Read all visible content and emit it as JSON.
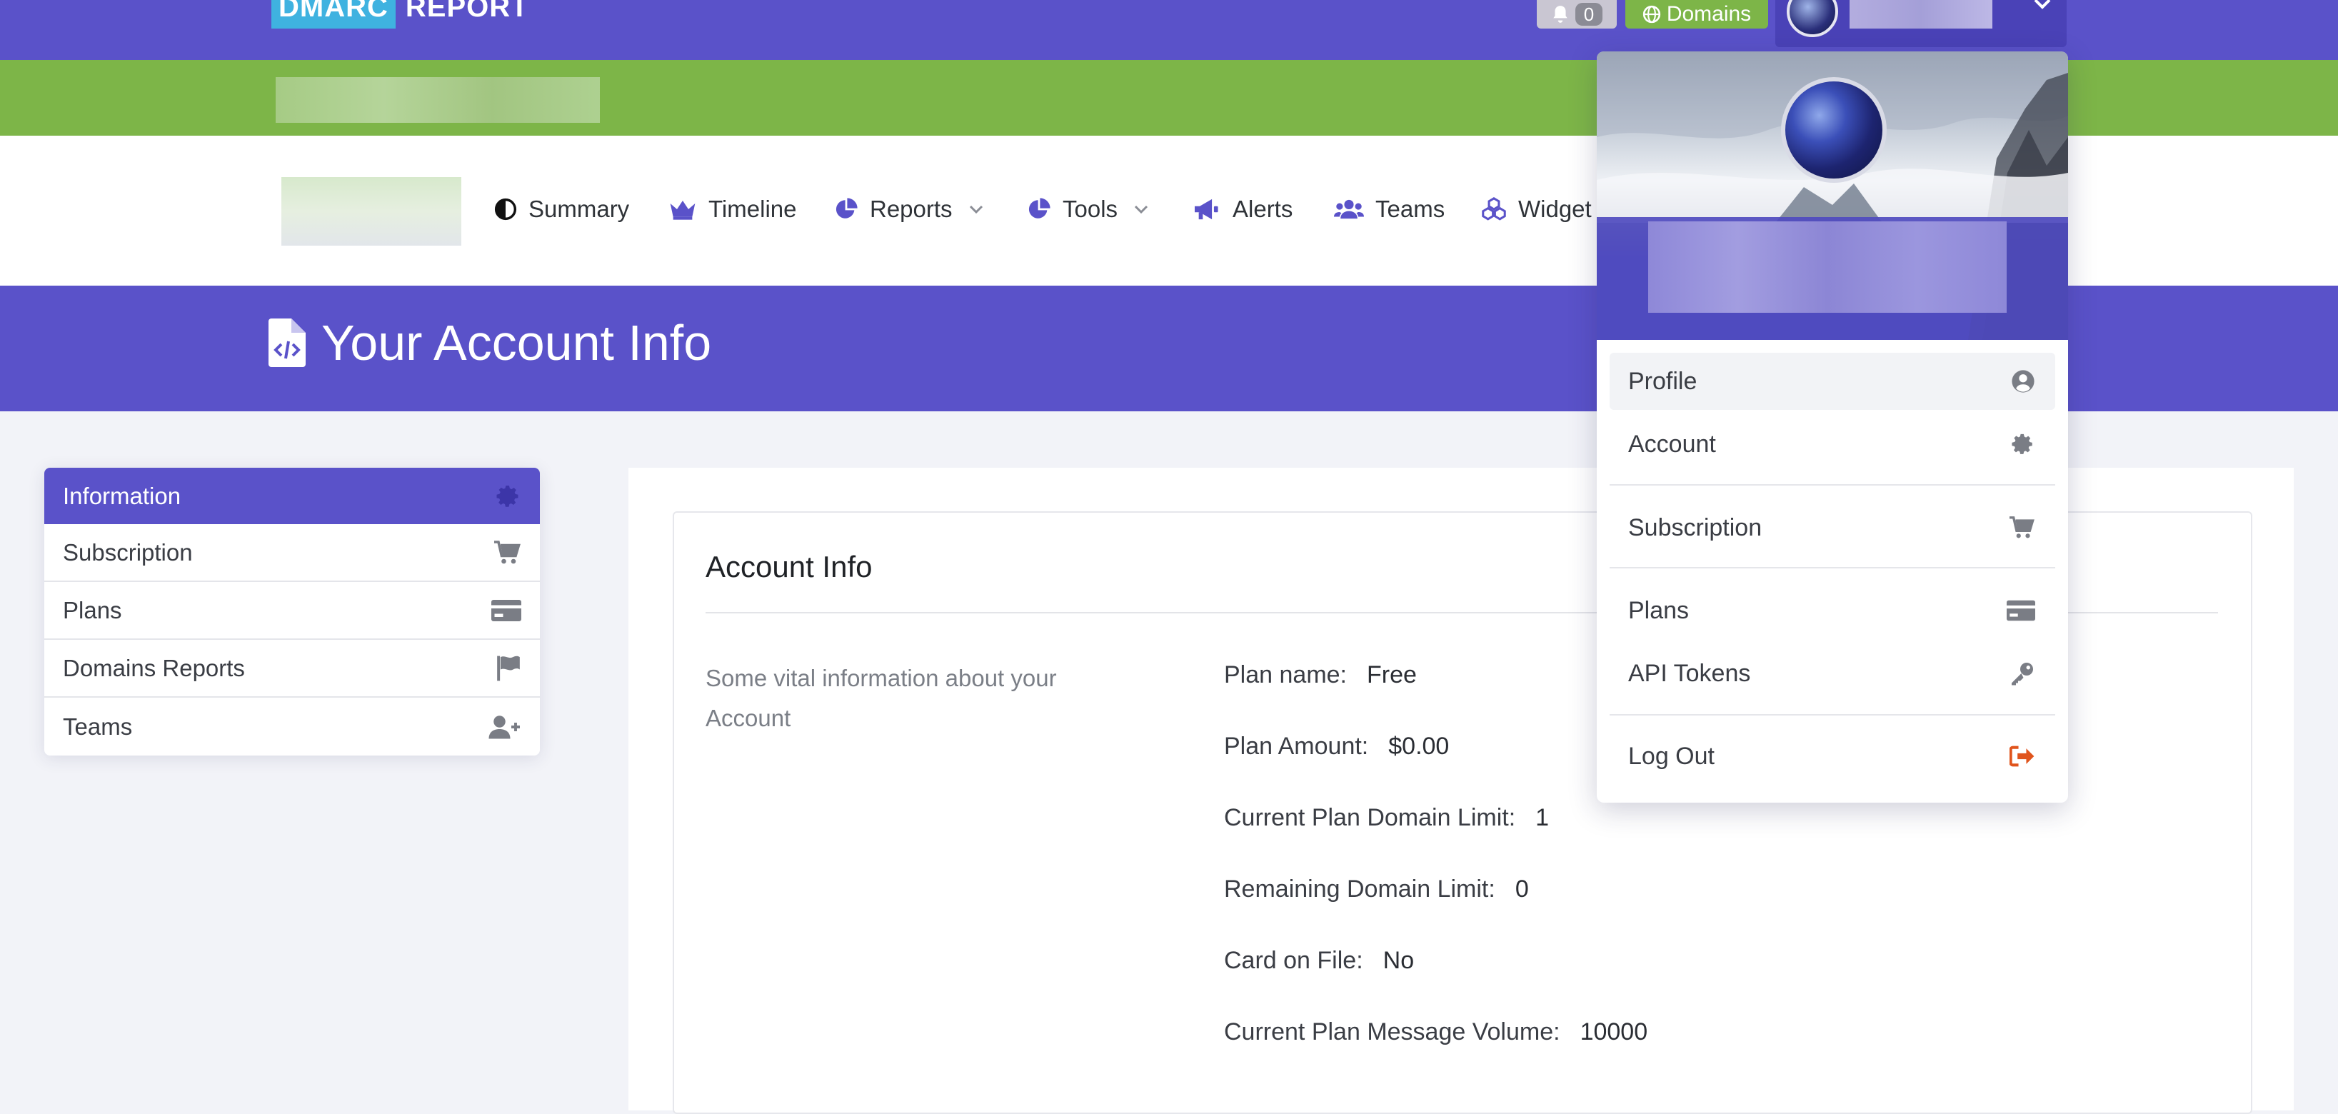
{
  "brand": {
    "part1": "DMARC",
    "part2": "REPORT"
  },
  "topbar": {
    "notification_count": "0",
    "domains_label": "Domains"
  },
  "nav": {
    "items": [
      {
        "label": "Summary",
        "icon": "half-circle-icon"
      },
      {
        "label": "Timeline",
        "icon": "crown-icon"
      },
      {
        "label": "Reports",
        "icon": "pie-chart-icon"
      },
      {
        "label": "Tools",
        "icon": "pie-chart-icon"
      },
      {
        "label": "Alerts",
        "icon": "megaphone-icon"
      },
      {
        "label": "Teams",
        "icon": "users-icon"
      },
      {
        "label": "Widget",
        "icon": "cubes-icon"
      }
    ]
  },
  "page": {
    "title": "Your Account Info"
  },
  "sidebar": {
    "items": [
      {
        "label": "Information",
        "icon": "gear-icon",
        "active": true
      },
      {
        "label": "Subscription",
        "icon": "cart-icon"
      },
      {
        "label": "Plans",
        "icon": "credit-card-icon"
      },
      {
        "label": "Domains Reports",
        "icon": "flag-icon"
      },
      {
        "label": "Teams",
        "icon": "user-plus-icon"
      }
    ]
  },
  "card": {
    "title": "Account Info",
    "description": "Some vital information about your Account",
    "rows": [
      {
        "label": "Plan name:",
        "value": "Free"
      },
      {
        "label": "Plan Amount:",
        "value": "$0.00"
      },
      {
        "label": "Current Plan Domain Limit:",
        "value": "1"
      },
      {
        "label": "Remaining Domain Limit:",
        "value": "0"
      },
      {
        "label": "Card on File:",
        "value": "No"
      },
      {
        "label": "Current Plan Message Volume:",
        "value": "10000"
      }
    ]
  },
  "dropdown": {
    "items": [
      {
        "label": "Profile",
        "icon": "user-circle-icon"
      },
      {
        "label": "Account",
        "icon": "gear-icon"
      },
      {
        "label": "Subscription",
        "icon": "cart-icon"
      },
      {
        "label": "Plans",
        "icon": "credit-card-icon"
      },
      {
        "label": "API Tokens",
        "icon": "key-icon"
      },
      {
        "label": "Log Out",
        "icon": "sign-out-icon"
      }
    ]
  },
  "colors": {
    "primary": "#5a52c9",
    "green": "#7db548",
    "brand_blue": "#3fb2e0",
    "logout": "#e0541c",
    "background": "#f2f3f8"
  }
}
